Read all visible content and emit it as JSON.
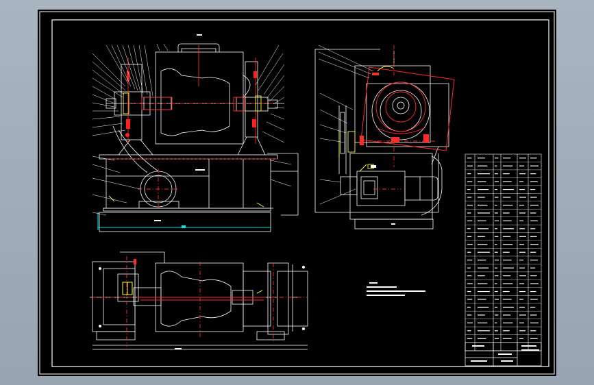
{
  "drawing": {
    "colors": {
      "background": "#a2adbb",
      "sheet": "#000000",
      "lines": "#ffffff",
      "center_lines": "#ff2020",
      "highlight": "#ffff00",
      "dimension": "#00e5e5",
      "hatching": "#ff3030"
    },
    "notes_block": {
      "lines": [
        "",
        "",
        "",
        ""
      ]
    },
    "parts_list": {
      "rows": 24
    },
    "title_block": {
      "text": ""
    }
  }
}
